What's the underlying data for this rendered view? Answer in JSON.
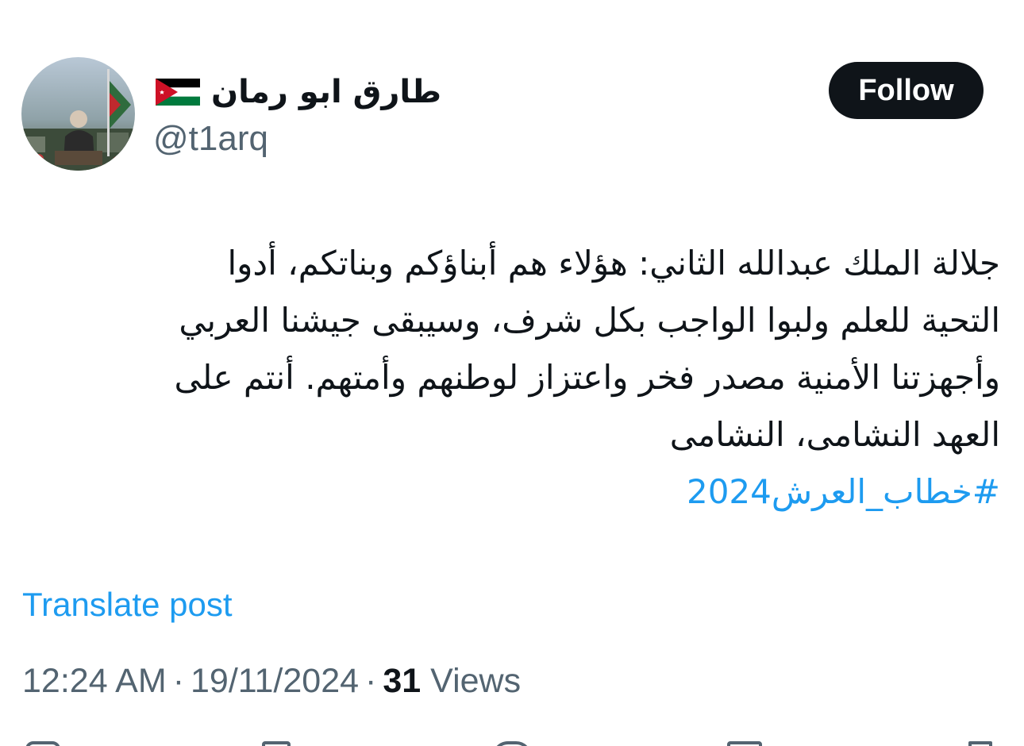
{
  "author": {
    "display_name": "طارق ابو رمان",
    "handle": "@t1arq",
    "flag_icon": "jordan-flag-icon",
    "avatar_icon": "profile-photo"
  },
  "follow_button": {
    "label": "Follow"
  },
  "tweet": {
    "lines": [
      "جلالة الملك عبدالله الثاني: هؤلاء هم أبناؤكم وبناتكم، أدوا",
      "التحية للعلم ولبوا الواجب بكل شرف، وسيبقى جيشنا العربي",
      "وأجهزتنا الأمنية مصدر فخر واعتزاز لوطنهم وأمتهم. أنتم على",
      "العهد النشامى، النشامى"
    ],
    "hashtag": "#خطاب_العرش2024"
  },
  "translate_link": "Translate post",
  "meta": {
    "time": "12:24 AM",
    "separator": "·",
    "date": "19/11/2024",
    "views_count": "31",
    "views_label": "Views"
  },
  "colors": {
    "link": "#1d9bf0",
    "text": "#0f1419",
    "secondary": "#536471",
    "button_bg": "#0f1419"
  },
  "action_icons": [
    "reply-icon",
    "repost-icon",
    "like-icon",
    "bookmark-icon",
    "share-icon"
  ]
}
